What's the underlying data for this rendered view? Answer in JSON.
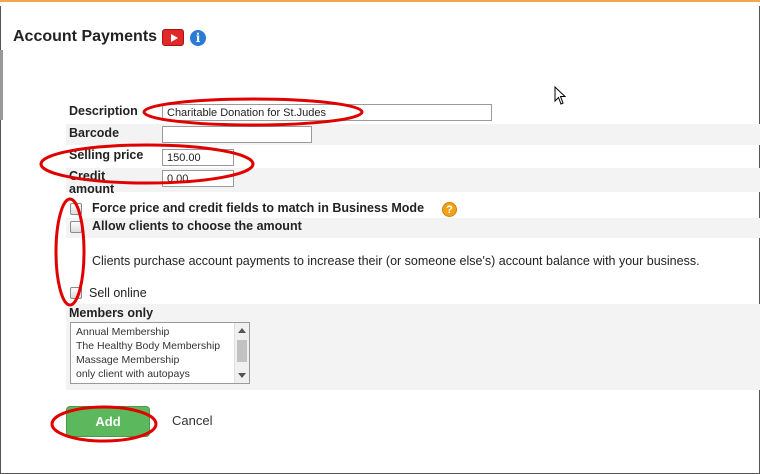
{
  "page": {
    "title": "Account Payments"
  },
  "icons": {
    "video": "video-play-icon",
    "info": "info-icon",
    "help": "help-icon",
    "cursor": "mouse-cursor-icon"
  },
  "form": {
    "description": {
      "label": "Description",
      "value": "Charitable Donation for St.Judes"
    },
    "barcode": {
      "label": "Barcode",
      "value": ""
    },
    "selling_price": {
      "label": "Selling price",
      "value": "150.00"
    },
    "credit_amount": {
      "label": "Credit amount",
      "value": "0.00"
    },
    "force_match": {
      "label": "Force price and credit fields to match in Business Mode",
      "checked": false
    },
    "allow_choose": {
      "label": "Allow clients to choose the amount",
      "checked": false
    },
    "description_text": "Clients purchase account payments to increase their (or someone else's) account balance with your business.",
    "sell_online": {
      "label": "Sell online",
      "checked": false
    },
    "members_only": {
      "label": "Members only",
      "options": [
        "Annual Membership",
        "The Healthy Body Membership",
        "Massage Membership",
        "only client with autopays"
      ]
    }
  },
  "actions": {
    "add_label": "Add",
    "cancel_label": "Cancel"
  },
  "colors": {
    "accent_top": "#f0a64a",
    "add_button": "#5cb85c",
    "annotation": "#e00000"
  }
}
